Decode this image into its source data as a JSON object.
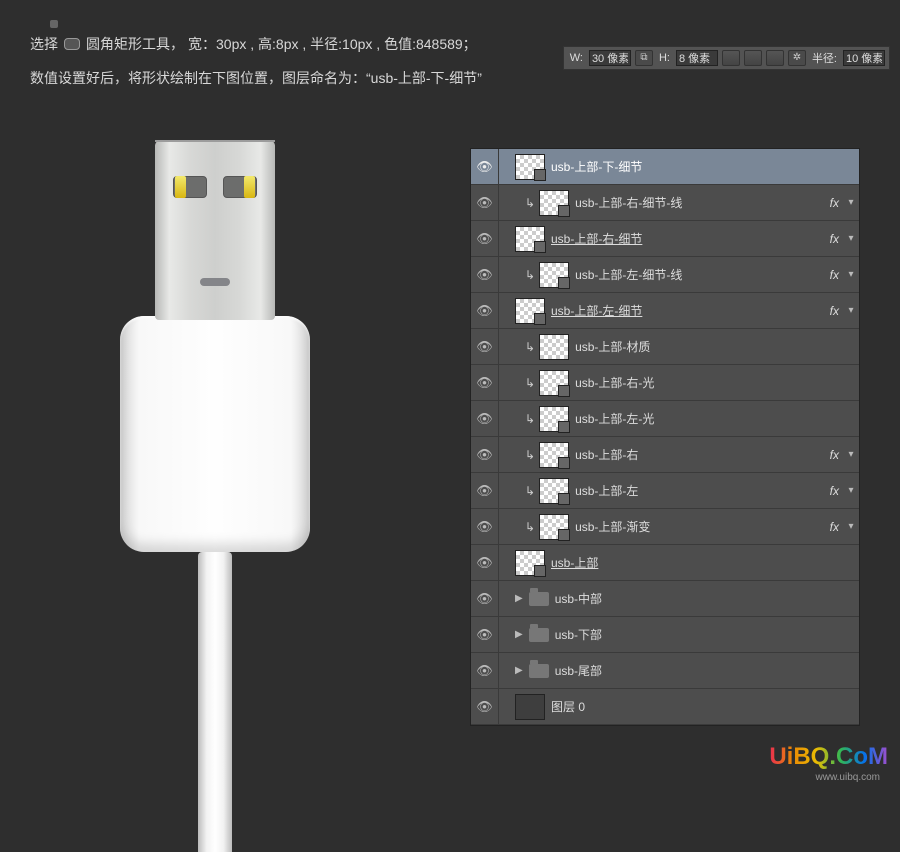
{
  "instructions": {
    "select": "选择",
    "tool_name": "圆角矩形工具，",
    "dimensions": "宽：30px , 高:8px , 半径:10px , 色值:848589；",
    "line2": "数值设置好后，将形状绘制在下图位置，图层命名为：“usb-上部-下-细节”"
  },
  "options_bar": {
    "w_label": "W:",
    "w_value": "30 像素",
    "h_label": "H:",
    "h_value": "8 像素",
    "radius_label": "半径:",
    "radius_value": "10 像素"
  },
  "layers": [
    {
      "name": "usb-上部-下-细节",
      "indent": 1,
      "selected": true,
      "thumb": "vector",
      "fx": false,
      "underline": false,
      "clip": false,
      "folder": false
    },
    {
      "name": "usb-上部-右-细节-线",
      "indent": 2,
      "selected": false,
      "thumb": "vector",
      "fx": true,
      "underline": false,
      "clip": true,
      "folder": false
    },
    {
      "name": "usb-上部-右-细节",
      "indent": 1,
      "selected": false,
      "thumb": "vector",
      "fx": true,
      "underline": true,
      "clip": false,
      "folder": false
    },
    {
      "name": "usb-上部-左-细节-线",
      "indent": 2,
      "selected": false,
      "thumb": "vector",
      "fx": true,
      "underline": false,
      "clip": true,
      "folder": false
    },
    {
      "name": "usb-上部-左-细节",
      "indent": 1,
      "selected": false,
      "thumb": "vector",
      "fx": true,
      "underline": true,
      "clip": false,
      "folder": false
    },
    {
      "name": "usb-上部-材质",
      "indent": 2,
      "selected": false,
      "thumb": "plain",
      "fx": false,
      "underline": false,
      "clip": true,
      "folder": false
    },
    {
      "name": "usb-上部-右-光",
      "indent": 2,
      "selected": false,
      "thumb": "vector",
      "fx": false,
      "underline": false,
      "clip": true,
      "folder": false
    },
    {
      "name": "usb-上部-左-光",
      "indent": 2,
      "selected": false,
      "thumb": "vector",
      "fx": false,
      "underline": false,
      "clip": true,
      "folder": false
    },
    {
      "name": "usb-上部-右",
      "indent": 2,
      "selected": false,
      "thumb": "vector",
      "fx": true,
      "underline": false,
      "clip": true,
      "folder": false
    },
    {
      "name": "usb-上部-左",
      "indent": 2,
      "selected": false,
      "thumb": "vector",
      "fx": true,
      "underline": false,
      "clip": true,
      "folder": false
    },
    {
      "name": "usb-上部-渐变",
      "indent": 2,
      "selected": false,
      "thumb": "vector",
      "fx": true,
      "underline": false,
      "clip": true,
      "folder": false
    },
    {
      "name": "usb-上部",
      "indent": 1,
      "selected": false,
      "thumb": "vector",
      "fx": false,
      "underline": true,
      "clip": false,
      "folder": false
    },
    {
      "name": "usb-中部",
      "indent": 1,
      "selected": false,
      "thumb": "folder",
      "fx": false,
      "underline": false,
      "clip": false,
      "folder": true
    },
    {
      "name": "usb-下部",
      "indent": 1,
      "selected": false,
      "thumb": "folder",
      "fx": false,
      "underline": false,
      "clip": false,
      "folder": true
    },
    {
      "name": "usb-尾部",
      "indent": 1,
      "selected": false,
      "thumb": "folder",
      "fx": false,
      "underline": false,
      "clip": false,
      "folder": true
    },
    {
      "name": "图层 0",
      "indent": 1,
      "selected": false,
      "thumb": "dark",
      "fx": false,
      "underline": false,
      "clip": false,
      "folder": false
    }
  ],
  "watermark": {
    "text": "UiBQ.CoM",
    "sub": "www.uibq.com"
  }
}
